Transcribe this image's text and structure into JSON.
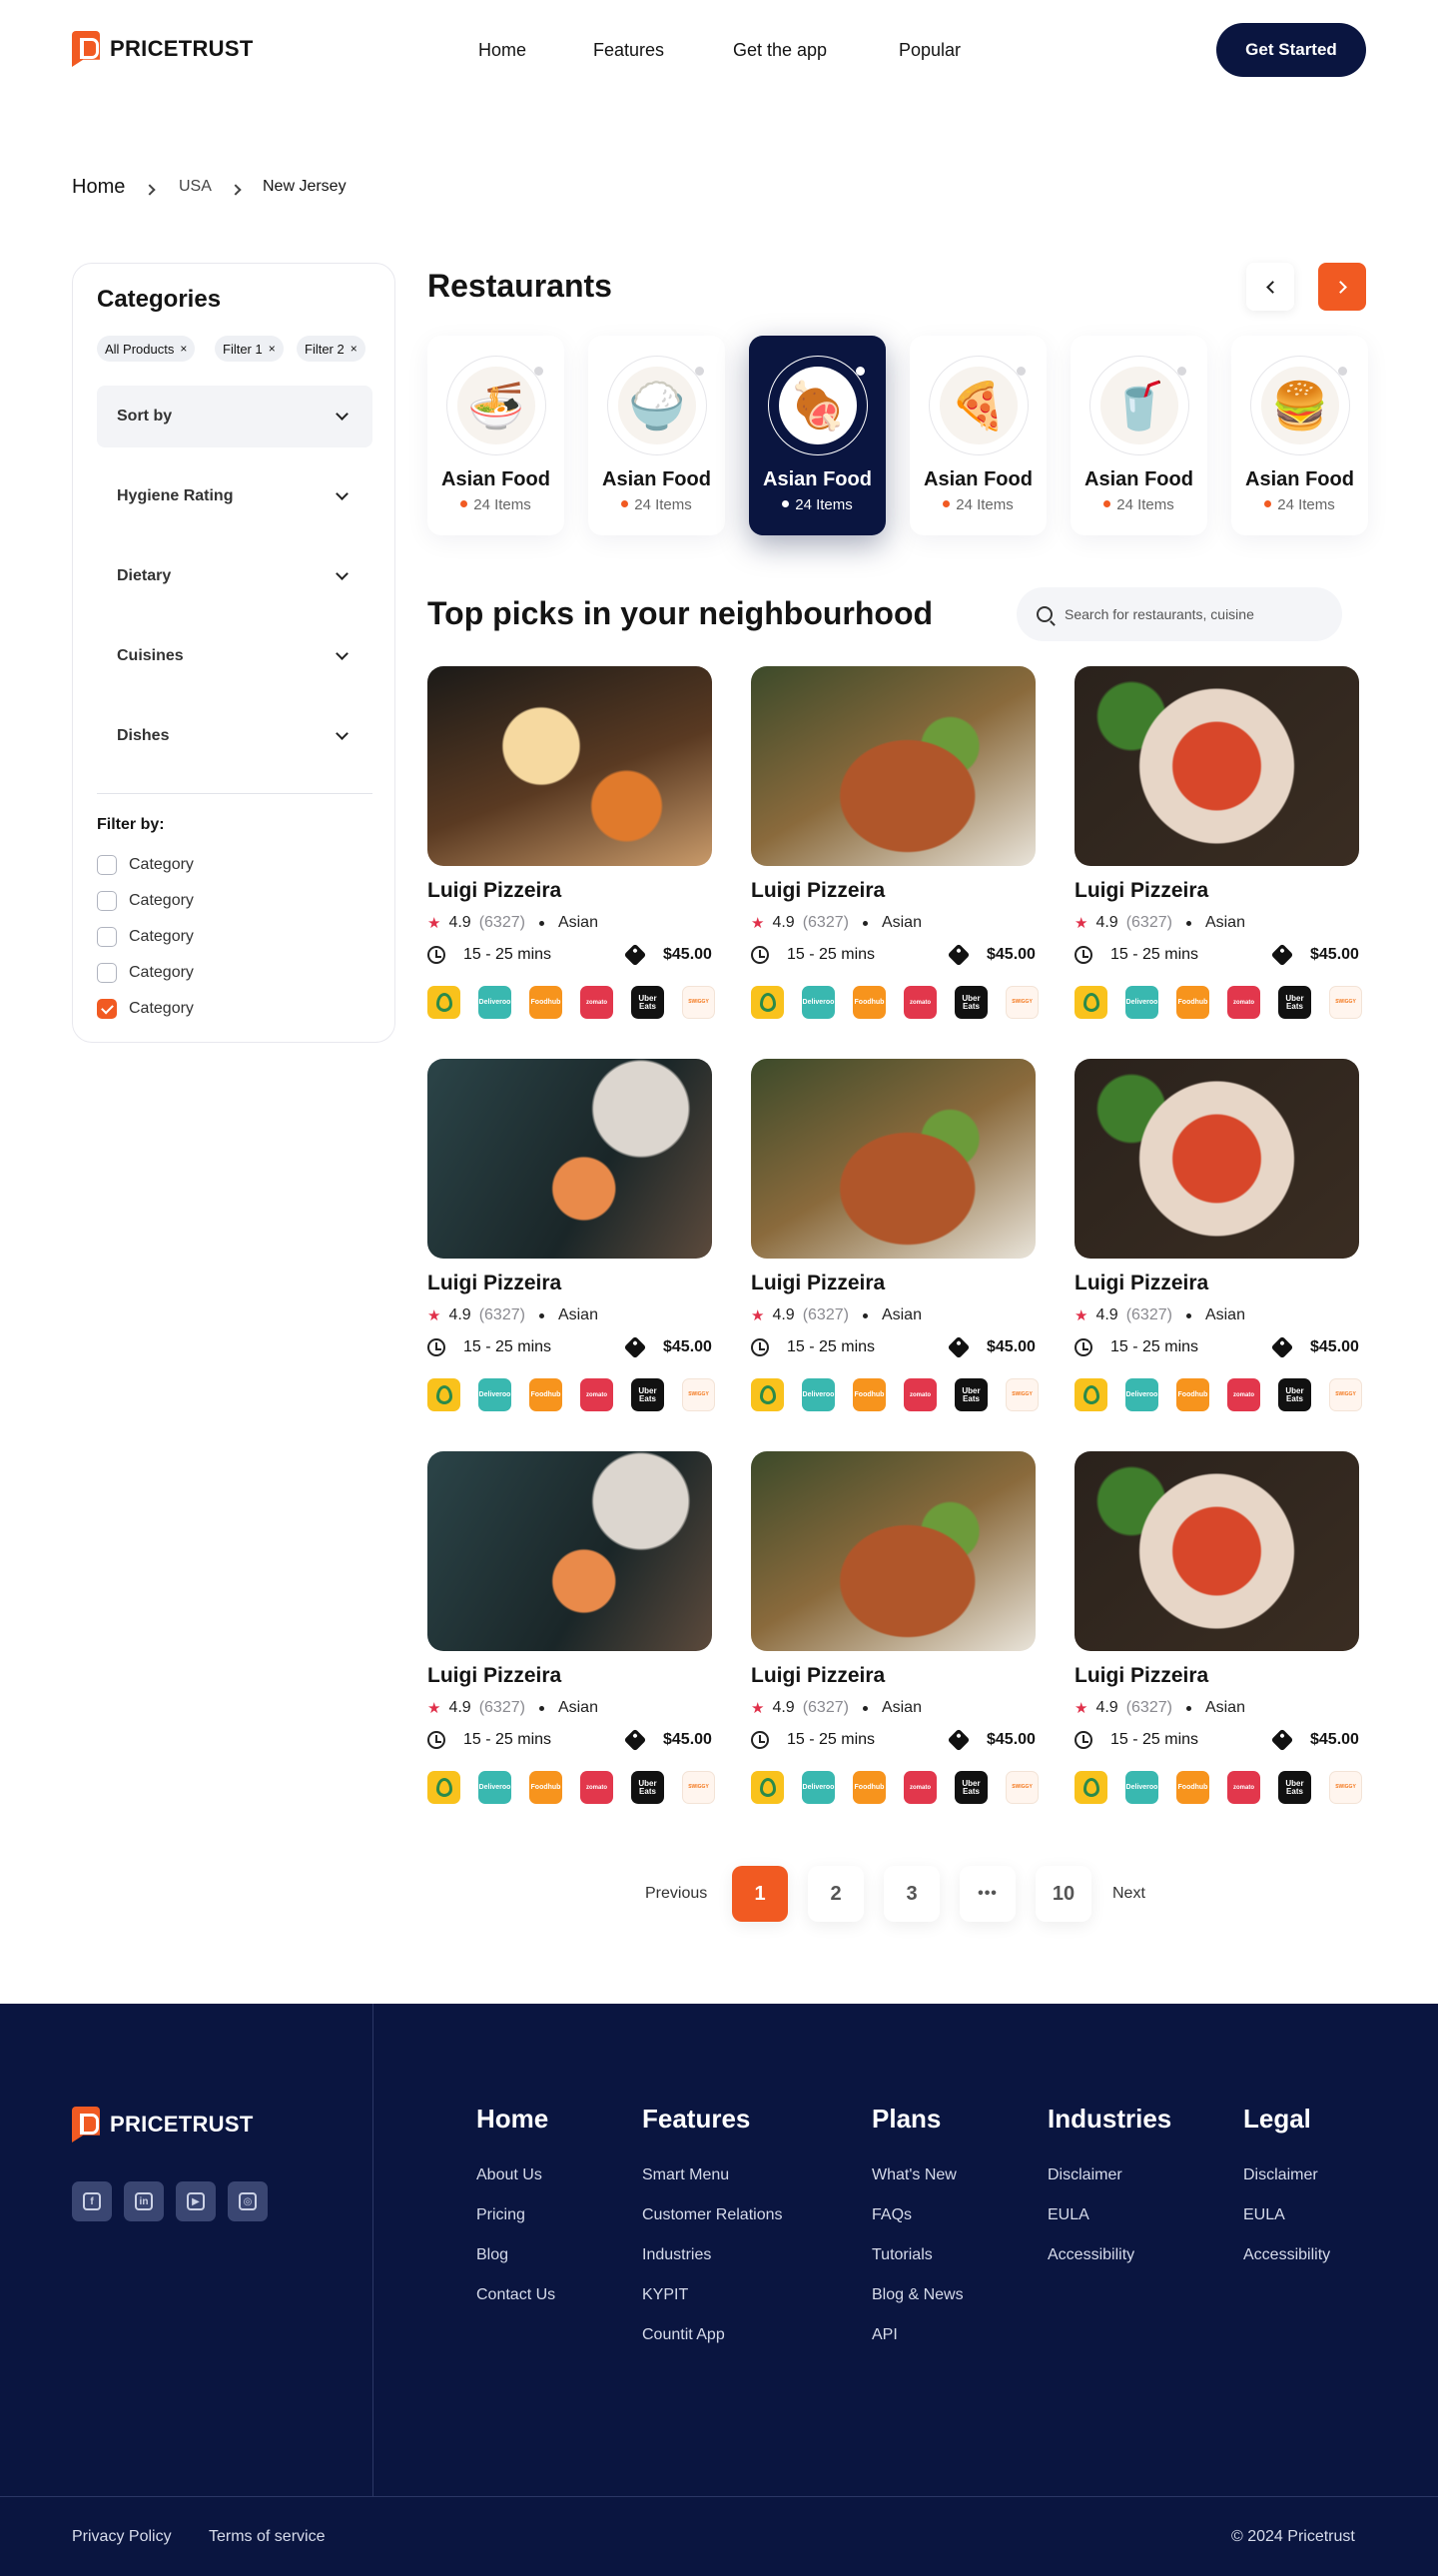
{
  "brand": {
    "name": "PRICETRUST"
  },
  "nav": {
    "items": [
      "Home",
      "Features",
      "Get the app",
      "Popular"
    ],
    "cta": "Get Started"
  },
  "breadcrumb": [
    "Home",
    "USA",
    "New Jersey"
  ],
  "sidebar": {
    "title": "Categories",
    "chips": [
      "All Products",
      "Filter 1",
      "Filter 2"
    ],
    "chip_remove": "×",
    "accordions": [
      "Sort by",
      "Hygiene Rating",
      "Dietary",
      "Cuisines",
      "Dishes"
    ],
    "filter_title": "Filter by:",
    "checkboxes": [
      {
        "label": "Category",
        "checked": false
      },
      {
        "label": "Category",
        "checked": false
      },
      {
        "label": "Category",
        "checked": false
      },
      {
        "label": "Category",
        "checked": false
      },
      {
        "label": "Category",
        "checked": true
      }
    ]
  },
  "restaurants": {
    "title": "Restaurants",
    "categories": [
      {
        "name": "Asian Food",
        "items": "24 Items",
        "icon": "noodle-bowl-icon",
        "active": false
      },
      {
        "name": "Asian Food",
        "items": "24 Items",
        "icon": "rice-bowl-icon",
        "active": false
      },
      {
        "name": "Asian Food",
        "items": "24 Items",
        "icon": "meat-icon",
        "active": true
      },
      {
        "name": "Asian Food",
        "items": "24 Items",
        "icon": "pizza-icon",
        "active": false
      },
      {
        "name": "Asian Food",
        "items": "24 Items",
        "icon": "drink-icon",
        "active": false
      },
      {
        "name": "Asian Food",
        "items": "24 Items",
        "icon": "burger-icon",
        "active": false
      }
    ]
  },
  "picks": {
    "title": "Top picks in your neighbourhood",
    "search_placeholder": "Search for restaurants, cuisine",
    "cards": [
      {
        "name": "Luigi Pizzeira",
        "rating": "4.9",
        "reviews": "(6327)",
        "cuisine": "Asian",
        "time": "15 - 25 mins",
        "price": "$45.00",
        "photo": "dumpling"
      },
      {
        "name": "Luigi Pizzeira",
        "rating": "4.9",
        "reviews": "(6327)",
        "cuisine": "Asian",
        "time": "15 - 25 mins",
        "price": "$45.00",
        "photo": "rice"
      },
      {
        "name": "Luigi Pizzeira",
        "rating": "4.9",
        "reviews": "(6327)",
        "cuisine": "Asian",
        "time": "15 - 25 mins",
        "price": "$45.00",
        "photo": "pasta"
      },
      {
        "name": "Luigi Pizzeira",
        "rating": "4.9",
        "reviews": "(6327)",
        "cuisine": "Asian",
        "time": "15 - 25 mins",
        "price": "$45.00",
        "photo": "hand"
      },
      {
        "name": "Luigi Pizzeira",
        "rating": "4.9",
        "reviews": "(6327)",
        "cuisine": "Asian",
        "time": "15 - 25 mins",
        "price": "$45.00",
        "photo": "rice"
      },
      {
        "name": "Luigi Pizzeira",
        "rating": "4.9",
        "reviews": "(6327)",
        "cuisine": "Asian",
        "time": "15 - 25 mins",
        "price": "$45.00",
        "photo": "pasta"
      },
      {
        "name": "Luigi Pizzeira",
        "rating": "4.9",
        "reviews": "(6327)",
        "cuisine": "Asian",
        "time": "15 - 25 mins",
        "price": "$45.00",
        "photo": "hand"
      },
      {
        "name": "Luigi Pizzeira",
        "rating": "4.9",
        "reviews": "(6327)",
        "cuisine": "Asian",
        "time": "15 - 25 mins",
        "price": "$45.00",
        "photo": "rice"
      },
      {
        "name": "Luigi Pizzeira",
        "rating": "4.9",
        "reviews": "(6327)",
        "cuisine": "Asian",
        "time": "15 - 25 mins",
        "price": "$45.00",
        "photo": "pasta"
      }
    ],
    "delivery_apps": [
      "Glovo",
      "Deliveroo",
      "Foodhub",
      "zomato",
      "Uber Eats",
      "SWIGGY"
    ]
  },
  "pagination": {
    "previous": "Previous",
    "next": "Next",
    "pages": [
      "1",
      "2",
      "3",
      "•••",
      "10"
    ],
    "current": "1"
  },
  "footer": {
    "columns": [
      {
        "title": "Home",
        "links": [
          "About Us",
          "Pricing",
          "Blog",
          "Contact Us"
        ]
      },
      {
        "title": "Features",
        "links": [
          "Smart Menu",
          "Customer Relations",
          "Industries",
          "KYPIT",
          "Countit App"
        ]
      },
      {
        "title": "Plans",
        "links": [
          "What's New",
          "FAQs",
          "Tutorials",
          "Blog & News",
          "API"
        ]
      },
      {
        "title": "Industries",
        "links": [
          "Disclaimer",
          "EULA",
          "Accessibility"
        ]
      },
      {
        "title": "Legal",
        "links": [
          "Disclaimer",
          "EULA",
          "Accessibility"
        ]
      }
    ],
    "social": [
      "facebook-icon",
      "linkedin-icon",
      "youtube-icon",
      "instagram-icon"
    ],
    "bottom_links": [
      "Privacy Policy",
      "Terms of service"
    ],
    "copyright": "© 2024 Pricetrust"
  },
  "colors": {
    "accent": "#f15a22",
    "navy": "#0a1540"
  }
}
